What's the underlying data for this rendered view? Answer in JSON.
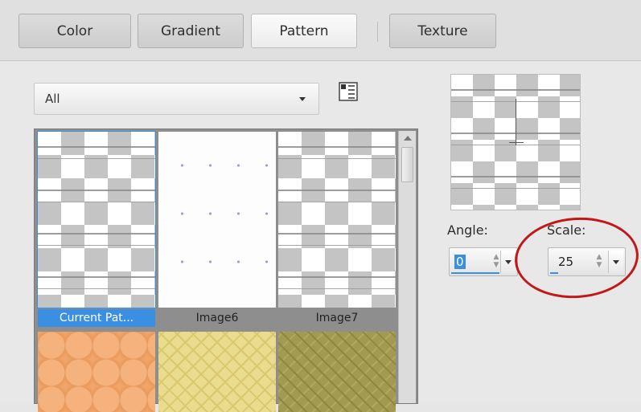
{
  "tabs": [
    {
      "label": "Color",
      "active": false
    },
    {
      "label": "Gradient",
      "active": false
    },
    {
      "label": "Pattern",
      "active": true
    },
    {
      "label": "Texture",
      "active": false
    }
  ],
  "filter": {
    "selected": "All"
  },
  "icons": {
    "list_view": "list-view-icon",
    "dropdown_arrow": "chevron-down-icon"
  },
  "patterns": [
    {
      "name": "Current Pat...",
      "selected": true
    },
    {
      "name": "Image6",
      "selected": false
    },
    {
      "name": "Image7",
      "selected": false
    }
  ],
  "angle": {
    "label": "Angle:",
    "value": "0"
  },
  "scale": {
    "label": "Scale:",
    "value": "25"
  },
  "colors": {
    "accent": "#3a8fe0",
    "annotation": "#c21818"
  }
}
